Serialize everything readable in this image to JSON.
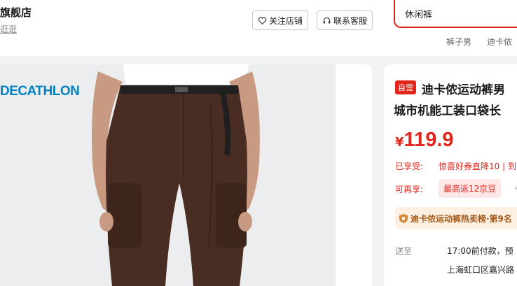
{
  "store": {
    "name": "旗舰店",
    "subtitle": "逛逛"
  },
  "header": {
    "follow_label": "关注店铺",
    "service_label": "联系客服",
    "search_value": "休闲裤",
    "hot_links": [
      "裤子男",
      "迪卡侬"
    ]
  },
  "gallery": {
    "brand_logo": "DECATHLON"
  },
  "product": {
    "badge": "自营",
    "title_line1": "迪卡侬运动裤男",
    "title_line2": "城市机能工装口袋长",
    "price_symbol": "¥",
    "price": "119.9",
    "enjoy_label": "已享受:",
    "enjoy_value": "惊喜好券直降10 | 到",
    "more_label": "可再享:",
    "more_value": "最高返12京豆",
    "rank_text": "迪卡侬运动裤热卖榜·第9名",
    "ship_label": "送至",
    "ship_time": "17:00前付款，预",
    "ship_address": "上海虹口区嘉兴路"
  },
  "colors": {
    "accent": "#e1251b",
    "rank_bg": "#fdf0e3",
    "brand": "#0082c3"
  }
}
